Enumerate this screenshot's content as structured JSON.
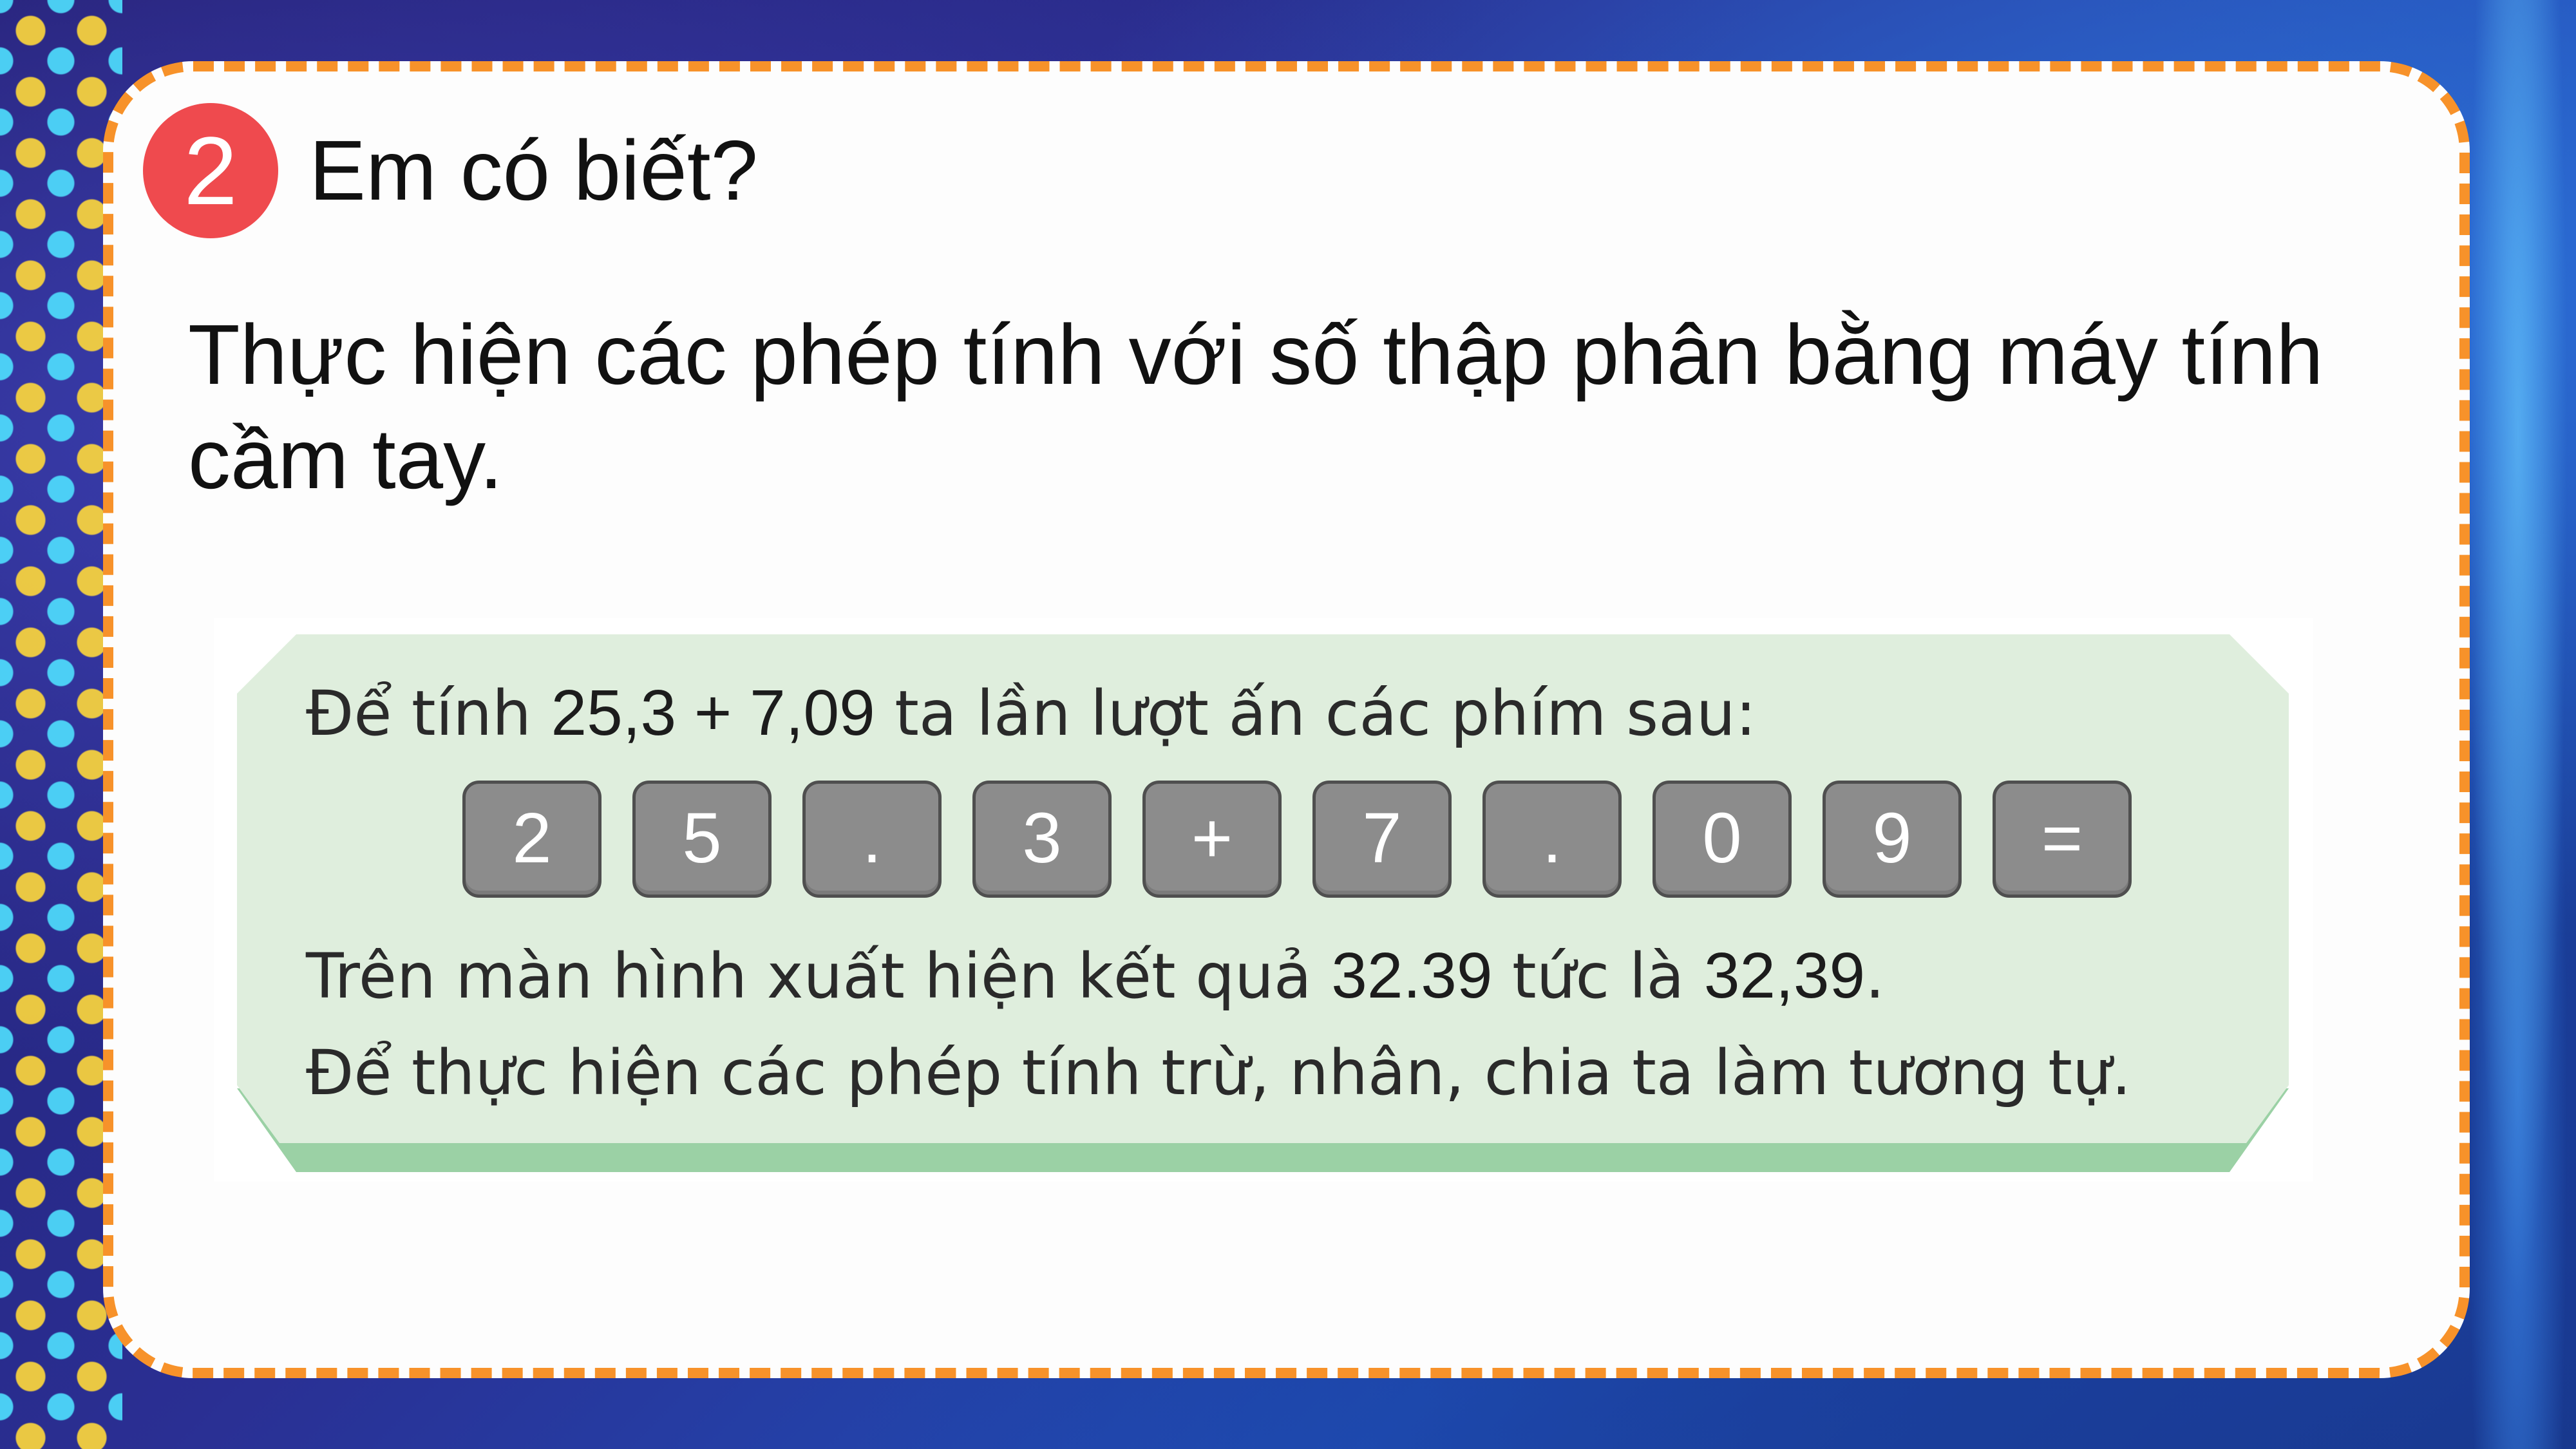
{
  "section": {
    "number": "2",
    "title": "Em có biết?"
  },
  "description": "Thực hiện các phép tính với số thập phân bằng máy tính cầm tay.",
  "example": {
    "intro_prefix": "Để tính ",
    "intro_expression": "25,3 + 7,09",
    "intro_suffix": " ta lần lượt ấn các phím sau:",
    "keys": [
      "2",
      "5",
      ".",
      "3",
      "+",
      "7",
      ".",
      "0",
      "9",
      "="
    ],
    "result_prefix": "Trên màn hình xuất hiện kết quả ",
    "result_display": "32.39",
    "result_middle": " tức là ",
    "result_value": "32,39",
    "result_end": ".",
    "note": "Để thực hiện các phép tính trừ, nhân, chia ta làm tương tự."
  },
  "colors": {
    "badge": "#ef4a4e",
    "card_border": "#f7922a",
    "panel": "#dfeedd",
    "panel_edge": "#9bd1a5",
    "key": "#8c8c8c"
  }
}
